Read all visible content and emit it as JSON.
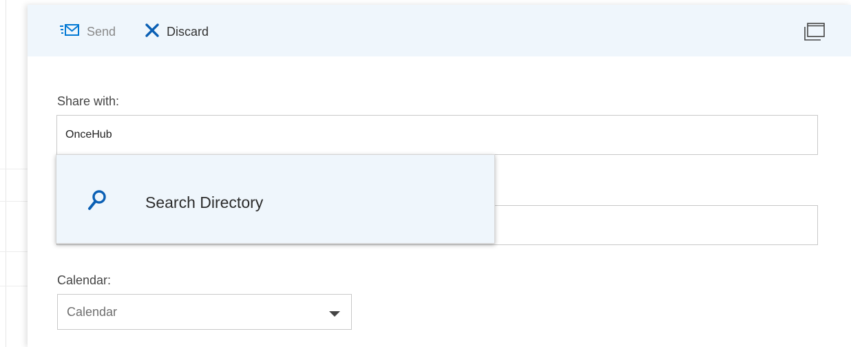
{
  "toolbar": {
    "send_label": "Send",
    "discard_label": "Discard",
    "send_icon": "send-mail-icon",
    "discard_icon": "close-x-icon",
    "popout_icon": "pop-out-window-icon"
  },
  "form": {
    "share_label": "Share with:",
    "share_value": "OnceHub",
    "second_value": "",
    "calendar_label": "Calendar:",
    "calendar_selected": "Calendar"
  },
  "suggestion": {
    "label": "Search Directory",
    "icon": "search-icon"
  },
  "colors": {
    "accent": "#0078d4",
    "toolbar_bg": "#eff6fc",
    "suggestion_bg": "#eff6fc",
    "border": "#c8c8c8"
  }
}
